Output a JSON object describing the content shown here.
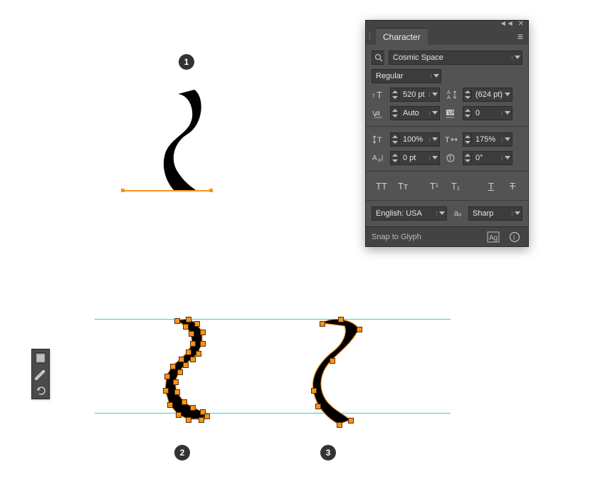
{
  "colors": {
    "panel_bg": "#535353",
    "panel_dark": "#434343",
    "field_bg": "#3c3c3c",
    "accent": "#f7931e",
    "guide": "#2ad4d4"
  },
  "badges": {
    "one": "1",
    "two": "2",
    "three": "3"
  },
  "toolstrip": {
    "fill_swatch": "fill-swatch",
    "smooth": "smooth-tool",
    "undo": "undo-tool"
  },
  "panel": {
    "tab": "Character",
    "menu_icon": "panel-menu",
    "collapse_icon": "collapse",
    "close_icon": "close",
    "font_family": "Cosmic Space",
    "font_style": "Regular",
    "font_size": "520 pt",
    "leading": "(624 pt)",
    "kerning": "Auto",
    "tracking": "0",
    "vscale": "100%",
    "hscale": "175%",
    "baseline_shift": "0 pt",
    "rotation": "0°",
    "caps": {
      "allcaps": "TT",
      "smallcaps": "Tᴛ",
      "superscript": "T¹",
      "subscript": "T₁",
      "underline": "T",
      "strike": "T"
    },
    "language": "English: USA",
    "antialias_label": "aₐ",
    "antialias": "Sharp",
    "footer": {
      "snap": "Snap to Glyph",
      "glyph_btn": "Ag",
      "info_btn": "ⓘ"
    }
  }
}
